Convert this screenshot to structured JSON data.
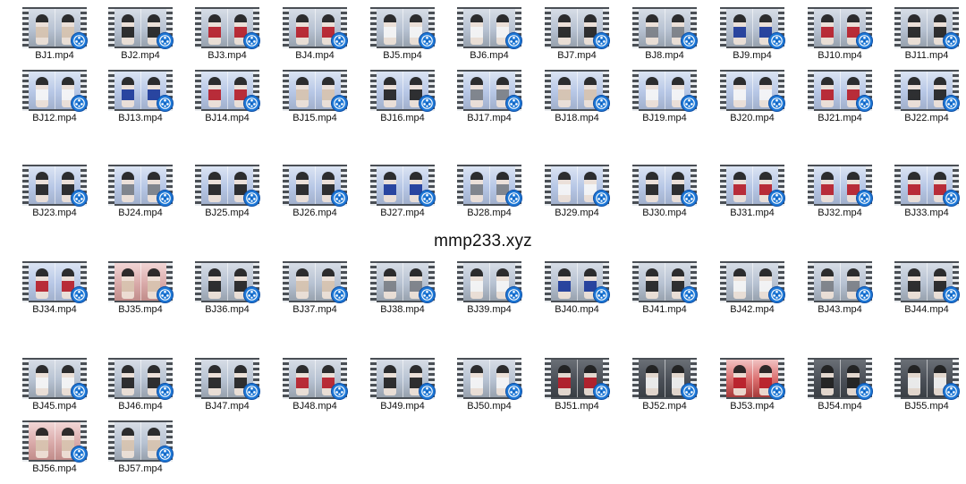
{
  "watermark": "mmp233.xyz",
  "files": [
    {
      "name": "BJ1.mp4",
      "theme": "default",
      "outfit": "beige"
    },
    {
      "name": "BJ2.mp4",
      "theme": "default",
      "outfit": "black"
    },
    {
      "name": "BJ3.mp4",
      "theme": "default",
      "outfit": "red"
    },
    {
      "name": "BJ4.mp4",
      "theme": "default",
      "outfit": "red"
    },
    {
      "name": "BJ5.mp4",
      "theme": "default",
      "outfit": "white"
    },
    {
      "name": "BJ6.mp4",
      "theme": "default",
      "outfit": "white"
    },
    {
      "name": "BJ7.mp4",
      "theme": "default",
      "outfit": "black"
    },
    {
      "name": "BJ8.mp4",
      "theme": "default",
      "outfit": "gray"
    },
    {
      "name": "BJ9.mp4",
      "theme": "default",
      "outfit": "blue"
    },
    {
      "name": "BJ10.mp4",
      "theme": "default",
      "outfit": "red"
    },
    {
      "name": "BJ11.mp4",
      "theme": "default",
      "outfit": "black"
    },
    {
      "name": "BJ12.mp4",
      "theme": "stage-blue",
      "outfit": "white"
    },
    {
      "name": "BJ13.mp4",
      "theme": "stage-blue",
      "outfit": "blue"
    },
    {
      "name": "BJ14.mp4",
      "theme": "stage-blue",
      "outfit": "red"
    },
    {
      "name": "BJ15.mp4",
      "theme": "stage-blue",
      "outfit": "beige"
    },
    {
      "name": "BJ16.mp4",
      "theme": "stage-blue",
      "outfit": "black"
    },
    {
      "name": "BJ17.mp4",
      "theme": "stage-blue",
      "outfit": "gray"
    },
    {
      "name": "BJ18.mp4",
      "theme": "stage-blue",
      "outfit": "beige"
    },
    {
      "name": "BJ19.mp4",
      "theme": "stage-blue",
      "outfit": "white"
    },
    {
      "name": "BJ20.mp4",
      "theme": "stage-blue",
      "outfit": "white"
    },
    {
      "name": "BJ21.mp4",
      "theme": "stage-blue",
      "outfit": "red"
    },
    {
      "name": "BJ22.mp4",
      "theme": "stage-blue",
      "outfit": "black"
    },
    {
      "name": "BJ23.mp4",
      "theme": "stage-blue",
      "outfit": "black"
    },
    {
      "name": "BJ24.mp4",
      "theme": "stage-blue",
      "outfit": "gray"
    },
    {
      "name": "BJ25.mp4",
      "theme": "stage-blue",
      "outfit": "black"
    },
    {
      "name": "BJ26.mp4",
      "theme": "stage-blue",
      "outfit": "black"
    },
    {
      "name": "BJ27.mp4",
      "theme": "stage-blue",
      "outfit": "blue"
    },
    {
      "name": "BJ28.mp4",
      "theme": "stage-blue",
      "outfit": "gray"
    },
    {
      "name": "BJ29.mp4",
      "theme": "stage-blue",
      "outfit": "white"
    },
    {
      "name": "BJ30.mp4",
      "theme": "stage-blue",
      "outfit": "black"
    },
    {
      "name": "BJ31.mp4",
      "theme": "stage-blue",
      "outfit": "red"
    },
    {
      "name": "BJ32.mp4",
      "theme": "stage-blue",
      "outfit": "red"
    },
    {
      "name": "BJ33.mp4",
      "theme": "stage-blue",
      "outfit": "red"
    },
    {
      "name": "BJ34.mp4",
      "theme": "stage-blue",
      "outfit": "red"
    },
    {
      "name": "BJ35.mp4",
      "theme": "stage-pink",
      "outfit": "beige"
    },
    {
      "name": "BJ36.mp4",
      "theme": "default",
      "outfit": "black"
    },
    {
      "name": "BJ37.mp4",
      "theme": "default",
      "outfit": "beige"
    },
    {
      "name": "BJ38.mp4",
      "theme": "default",
      "outfit": "gray"
    },
    {
      "name": "BJ39.mp4",
      "theme": "default",
      "outfit": "white"
    },
    {
      "name": "BJ40.mp4",
      "theme": "default",
      "outfit": "blue"
    },
    {
      "name": "BJ41.mp4",
      "theme": "default",
      "outfit": "black"
    },
    {
      "name": "BJ42.mp4",
      "theme": "default",
      "outfit": "white"
    },
    {
      "name": "BJ43.mp4",
      "theme": "default",
      "outfit": "gray"
    },
    {
      "name": "BJ44.mp4",
      "theme": "default",
      "outfit": "black"
    },
    {
      "name": "BJ45.mp4",
      "theme": "default",
      "outfit": "white"
    },
    {
      "name": "BJ46.mp4",
      "theme": "default",
      "outfit": "black"
    },
    {
      "name": "BJ47.mp4",
      "theme": "default",
      "outfit": "black"
    },
    {
      "name": "BJ48.mp4",
      "theme": "default",
      "outfit": "red"
    },
    {
      "name": "BJ49.mp4",
      "theme": "default",
      "outfit": "black"
    },
    {
      "name": "BJ50.mp4",
      "theme": "default",
      "outfit": "white"
    },
    {
      "name": "BJ51.mp4",
      "theme": "stage-dark",
      "outfit": "red"
    },
    {
      "name": "BJ52.mp4",
      "theme": "stage-dark",
      "outfit": "white"
    },
    {
      "name": "BJ53.mp4",
      "theme": "stage-red",
      "outfit": "red"
    },
    {
      "name": "BJ54.mp4",
      "theme": "stage-dark",
      "outfit": "black"
    },
    {
      "name": "BJ55.mp4",
      "theme": "stage-dark",
      "outfit": "white"
    },
    {
      "name": "BJ56.mp4",
      "theme": "stage-pink",
      "outfit": "beige"
    },
    {
      "name": "BJ57.mp4",
      "theme": "default",
      "outfit": "beige"
    }
  ],
  "icons": {
    "video_badge": "video-file-badge-icon",
    "film_reel": "film-strip-icon"
  },
  "colors": {
    "badge": "#1e78d6",
    "badge_dark": "#0f4fa5",
    "text": "#111111",
    "background": "#ffffff"
  }
}
